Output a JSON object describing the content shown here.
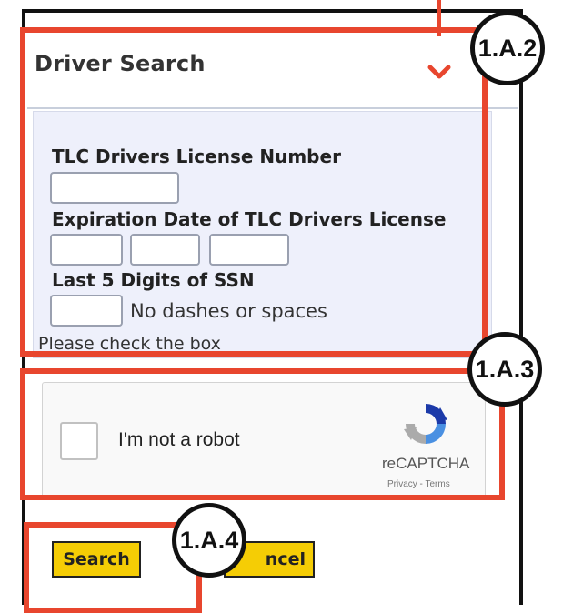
{
  "panel": {
    "title": "Driver Search",
    "license_label": "TLC Drivers License Number",
    "expiration_label": "Expiration Date of TLC Drivers License",
    "ssn_label": "Last 5 Digits of SSN",
    "ssn_hint": "No dashes or spaces",
    "check_note": "Please check the box"
  },
  "fields": {
    "license": "",
    "exp_month": "",
    "exp_day": "",
    "exp_year": "",
    "ssn": ""
  },
  "captcha": {
    "label": "I'm not a robot",
    "brand": "reCAPTCHA",
    "links": "Privacy - Terms",
    "checked": false
  },
  "buttons": {
    "search": "Search",
    "cancel": "ncel"
  },
  "annotations": {
    "callout_1": "1.A.2",
    "callout_2": "1.A.3",
    "callout_3": "1.A.4",
    "color": "#e8462e"
  }
}
